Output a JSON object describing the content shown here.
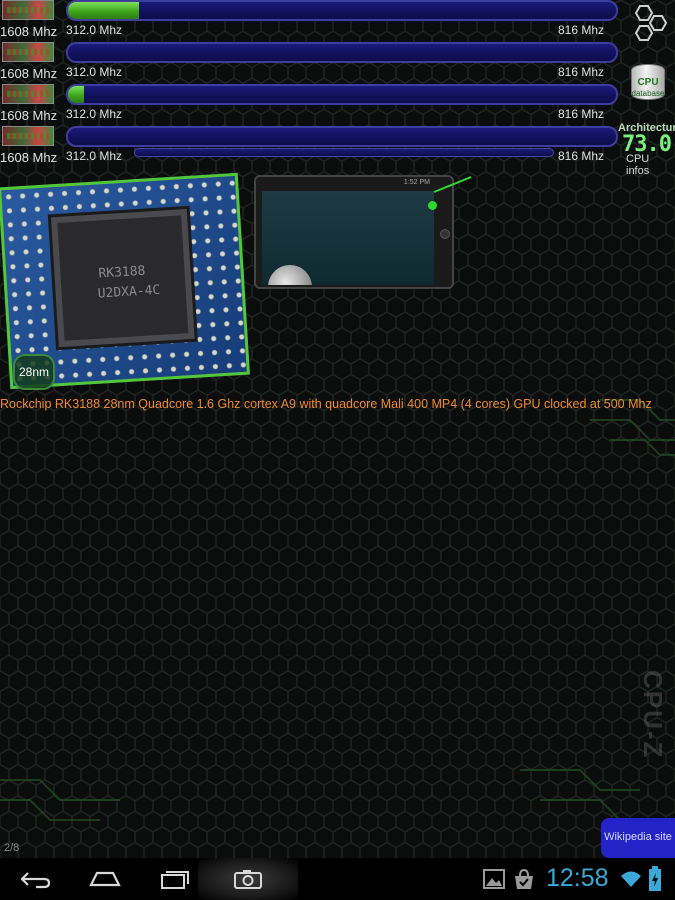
{
  "cores": [
    {
      "current_freq": "1608 Mhz",
      "min_label": "312.0 Mhz",
      "max_label": "816 Mhz",
      "load_fraction": 0.13
    },
    {
      "current_freq": "1608 Mhz",
      "min_label": "312.0 Mhz",
      "max_label": "816 Mhz",
      "load_fraction": 0.0
    },
    {
      "current_freq": "1608 Mhz",
      "min_label": "312.0 Mhz",
      "max_label": "816 Mhz",
      "load_fraction": 0.03
    },
    {
      "current_freq": "1608 Mhz",
      "min_label": "312.0 Mhz",
      "max_label": "816 Mhz",
      "load_fraction": 0.0
    }
  ],
  "side_buttons": {
    "db_label": "CPU",
    "db_sublabel": "database",
    "arch_title": "Architecture",
    "arch_value": "73.0",
    "arch_sub": "CPU infos"
  },
  "soc": {
    "chip_marking_1": "RK3188",
    "chip_marking_2": "U2DXA-4C",
    "process_node": "28nm",
    "description": "Rockchip RK3188 28nm Quadcore 1.6 Ghz cortex A9 with quadcore Mali 400 MP4 (4 cores) GPU clocked at 500 Mhz",
    "screenshot_status_time": "1:52 PM"
  },
  "footer": {
    "page_indicator": "2/8",
    "wiki_button": "Wikipedia site"
  },
  "system_bar": {
    "clock": "12:58",
    "accent": "#3aa8d8"
  },
  "colors": {
    "bar_fill": "#3ea61c",
    "bar_track": "#121260",
    "accent_green": "#52c838",
    "description_text": "#f08a2a"
  }
}
